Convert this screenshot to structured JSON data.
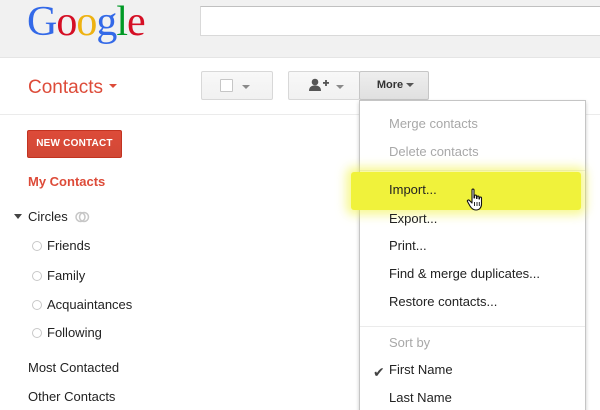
{
  "logo": {
    "letters": [
      "G",
      "o",
      "o",
      "g",
      "l",
      "e"
    ],
    "colors": [
      "#3369e8",
      "#d50f25",
      "#eeb211",
      "#3369e8",
      "#009925",
      "#d50f25"
    ]
  },
  "search": {
    "value": ""
  },
  "header": {
    "title": "Contacts",
    "more_label": "More"
  },
  "sidebar": {
    "new_contact": "NEW CONTACT",
    "my_contacts": "My Contacts",
    "circles_label": "Circles",
    "circles": [
      "Friends",
      "Family",
      "Acquaintances",
      "Following"
    ],
    "most_contacted": "Most Contacted",
    "other_contacts": "Other Contacts"
  },
  "menu": {
    "merge": "Merge contacts",
    "delete": "Delete contacts",
    "import": "Import...",
    "export": "Export...",
    "print": "Print...",
    "find_merge": "Find & merge duplicates...",
    "restore": "Restore contacts...",
    "sort_by": "Sort by",
    "first_name": "First Name",
    "last_name": "Last Name"
  },
  "colors": {
    "accent_red": "#dd4b39",
    "highlight": "#f0f23b"
  },
  "icons": {
    "add_person": "add-person-icon",
    "hand": "hand-pointer-icon",
    "check": "checkmark-icon",
    "circles": "circles-icon"
  }
}
